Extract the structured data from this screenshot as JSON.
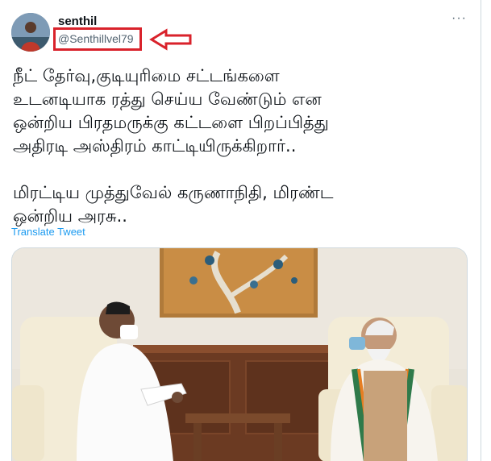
{
  "tweet": {
    "author": {
      "name": "senthil",
      "handle": "@Senthillvel79"
    },
    "text_lines": [
      "நீட் தேர்வு,குடியுரிமை சட்டங்களை",
      "உடனடியாக ரத்து செய்ய வேண்டும் என",
      "ஒன்றிய பிரதமருக்கு கட்டளை பிறப்பித்து",
      "அதிரடி அஸ்திரம் காட்டியிருக்கிறார்.."
    ],
    "text_lines_2": [
      "மிரட்டிய முத்துவேல் கருணாநிதி, மிரண்ட",
      "ஒன்றிய அரசு.."
    ],
    "translate_label": "Translate Tweet",
    "more_label": "···"
  },
  "colors": {
    "highlight": "#d9222b",
    "link": "#1d9bf0",
    "secondary_text": "#536471"
  },
  "icons": {
    "more": "more-options-icon",
    "annotation": "left-arrow-annotation"
  }
}
